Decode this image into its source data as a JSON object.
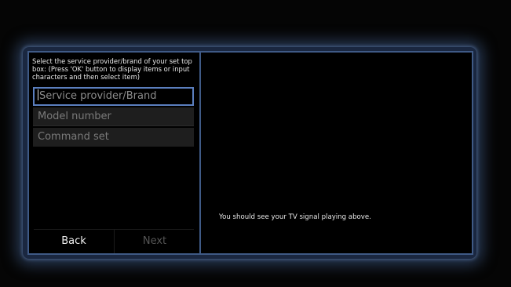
{
  "setup": {
    "instructions": "Select the service provider/brand of your set top box: (Press 'OK' button to display items or input characters and then select item)",
    "fields": {
      "provider_placeholder": "Service provider/Brand",
      "model_placeholder": "Model number",
      "command_placeholder": "Command set"
    },
    "buttons": {
      "back_label": "Back",
      "next_label": "Next"
    },
    "tv_message": "You should see your TV signal playing above."
  },
  "colors": {
    "accent_border": "#5b7fbf",
    "panel_border": "#3f5a86",
    "disabled_text": "#555555"
  }
}
